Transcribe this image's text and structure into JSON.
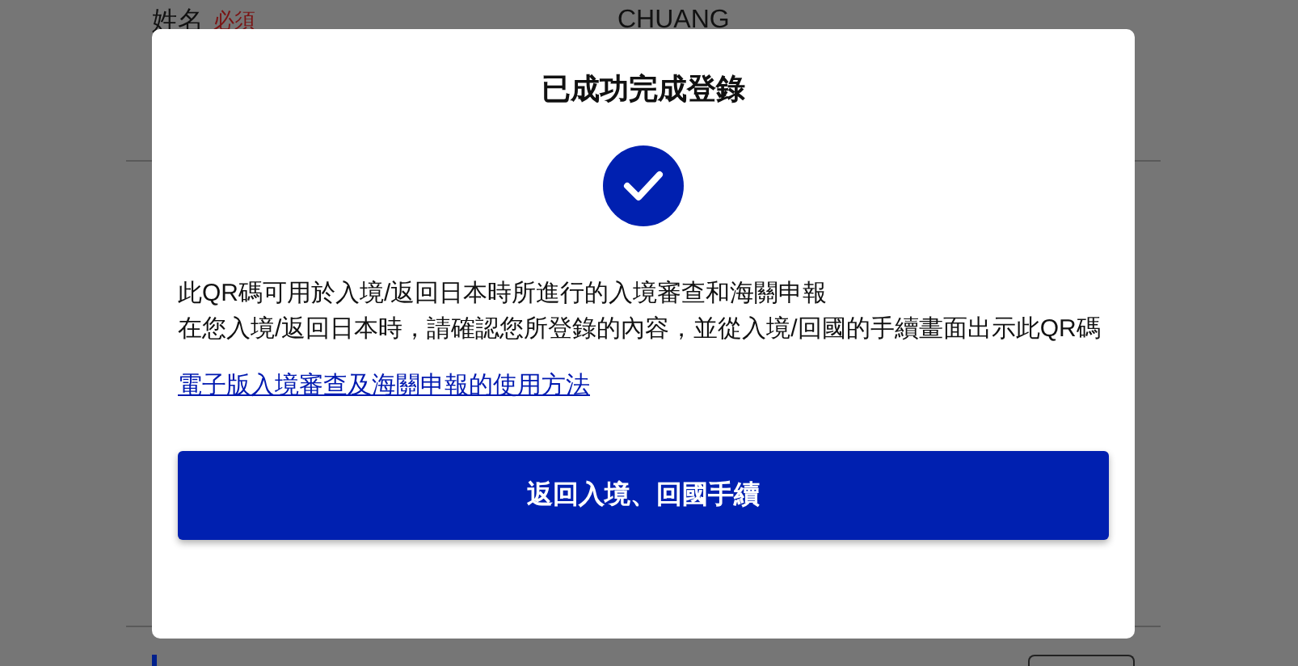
{
  "form": {
    "name_label": "姓名",
    "required_badge": "必須",
    "name_value": "CHUANG"
  },
  "dialog": {
    "title": "已成功完成登錄",
    "messages": [
      "此QR碼可用於入境/返回日本時所進行的入境審查和海關申報",
      "在您入境/返回日本時，請確認您所登錄的內容，並從入境/回國的手續畫面出示此QR碼"
    ],
    "link": "電子版入境審查及海關申報的使用方法",
    "button": "返回入境、回國手續"
  }
}
